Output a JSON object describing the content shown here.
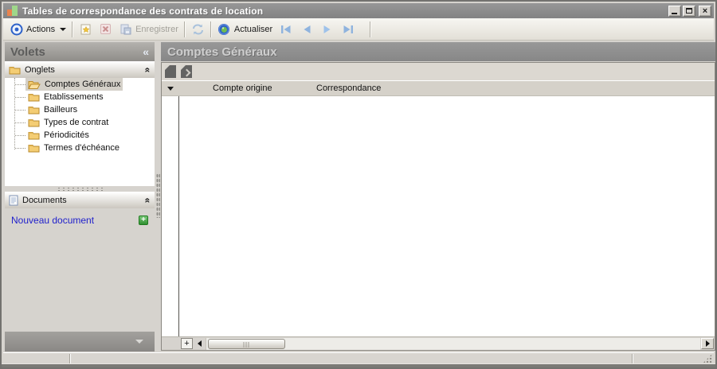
{
  "window": {
    "title": "Tables de correspondance des contrats de location"
  },
  "toolbar": {
    "actions_label": "Actions",
    "save_label": "Enregistrer",
    "refresh_label": "Actualiser"
  },
  "sidebar": {
    "title": "Volets",
    "collapse_glyph": "«",
    "chevron_glyph": "«",
    "onglets": {
      "label": "Onglets",
      "items": [
        "Comptes Généraux",
        "Etablissements",
        "Bailleurs",
        "Types de contrat",
        "Périodicités",
        "Termes d'échéance"
      ],
      "selected": "Comptes Généraux"
    },
    "documents": {
      "label": "Documents",
      "new_link": "Nouveau document",
      "add_glyph": "+"
    }
  },
  "main": {
    "title": "Comptes Généraux",
    "grid": {
      "columns": [
        "Compte origine",
        "Correspondance"
      ],
      "rows": [],
      "add_row_glyph": "+"
    }
  },
  "colors": {
    "titlebar_gray": "#8b8b8b",
    "accent_blue": "#2e62c9",
    "nav_blue": "#8fb3de",
    "link_blue": "#2121cc",
    "folder_yellow": "#f4cd74",
    "plus_green": "#2f8f30",
    "refresh_green": "#6ebc52"
  }
}
